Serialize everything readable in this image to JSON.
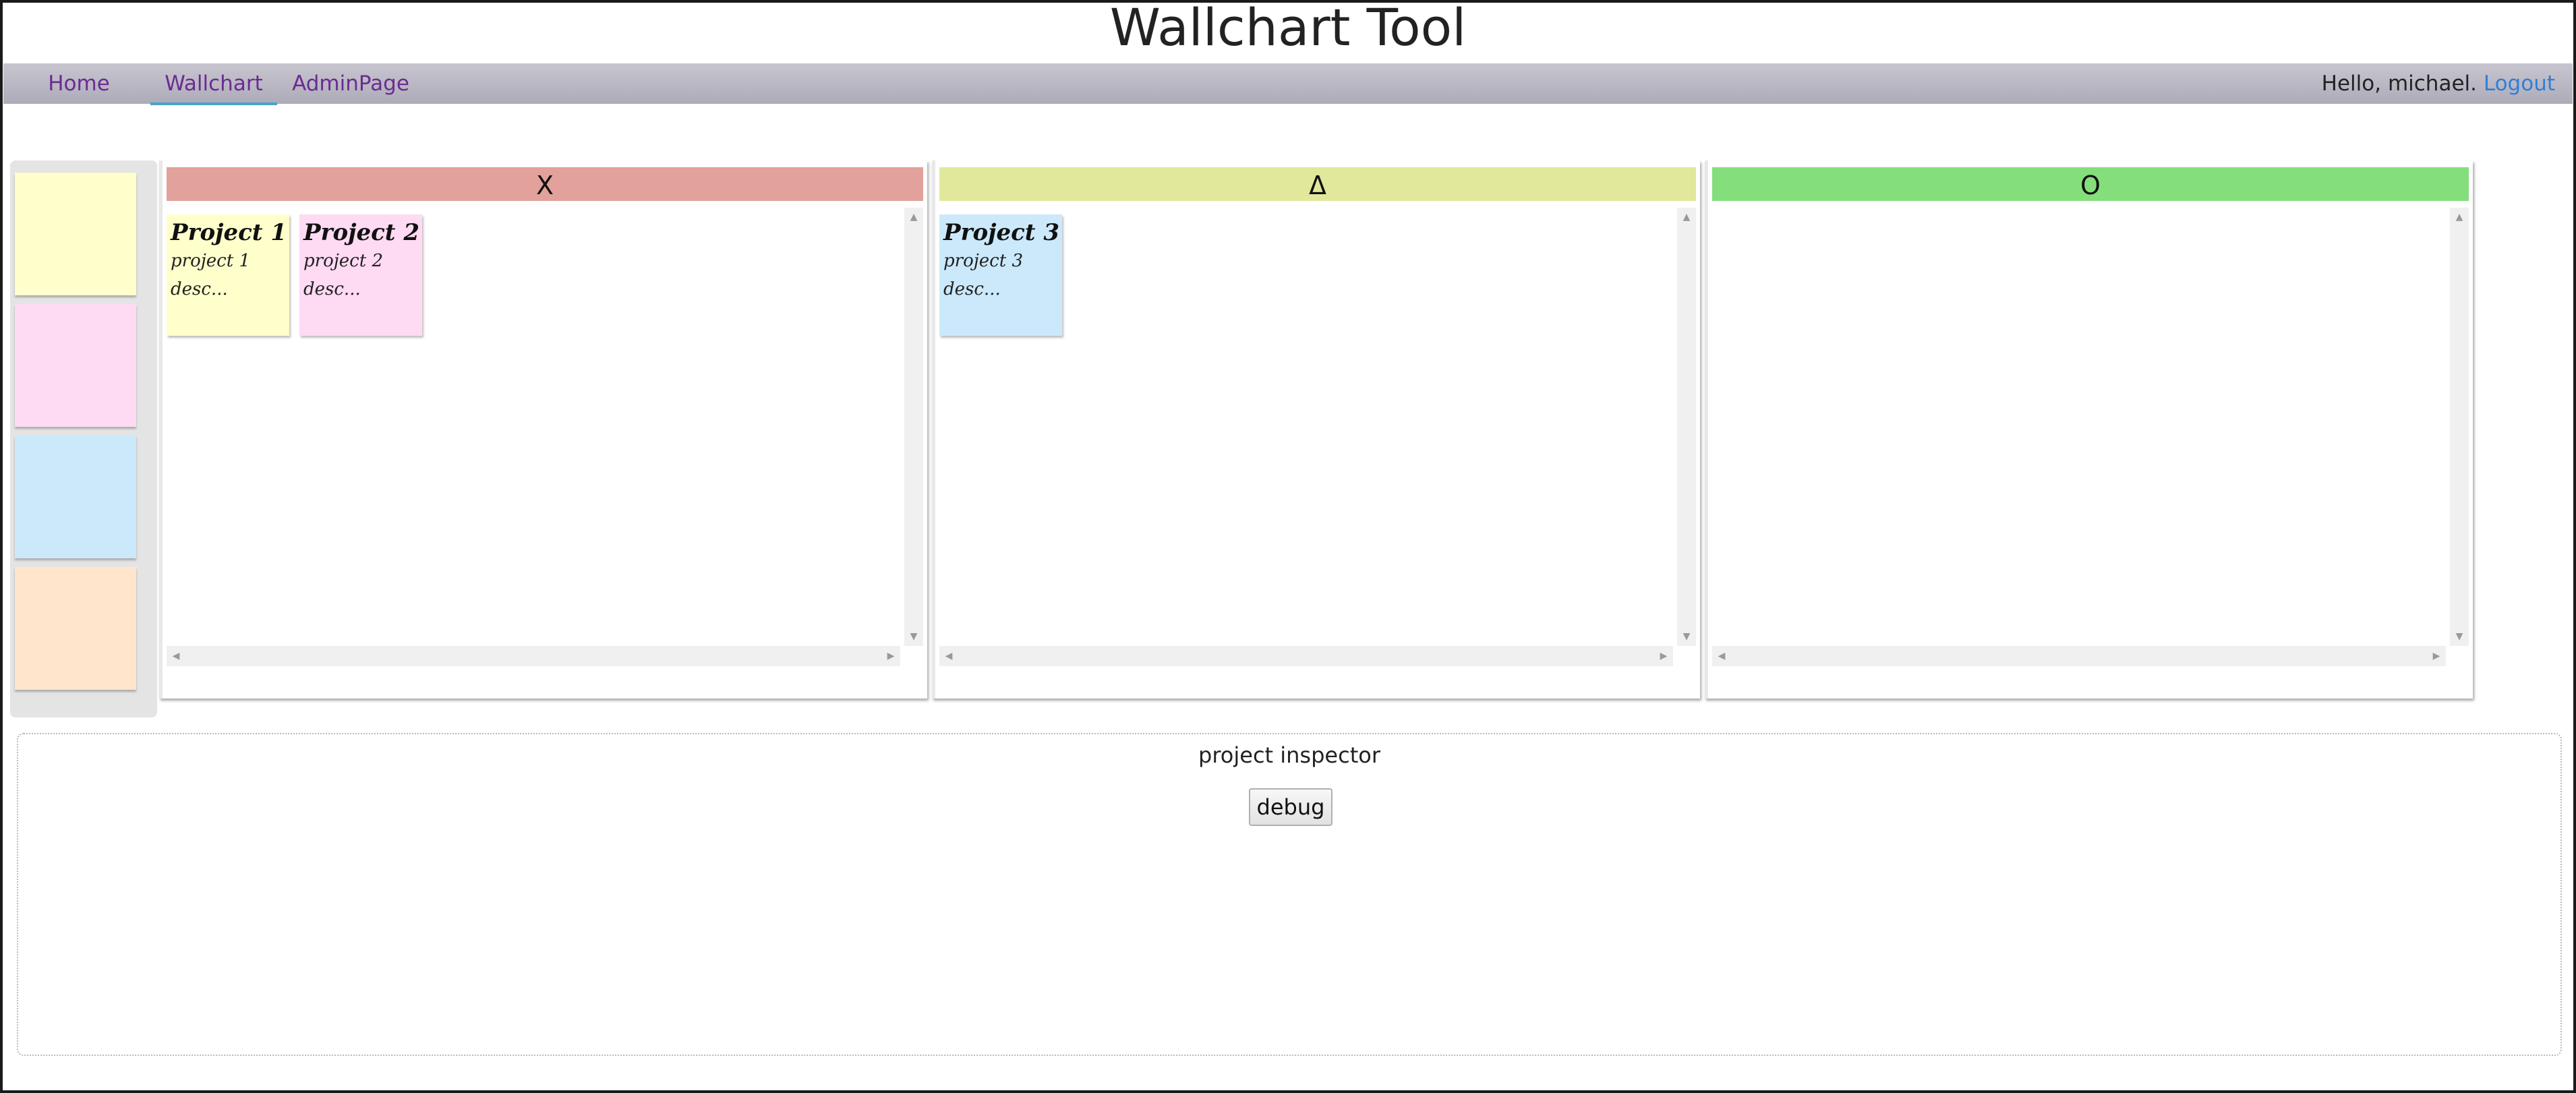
{
  "app": {
    "title": "Wallchart Tool"
  },
  "nav": {
    "items": [
      {
        "label": "Home"
      },
      {
        "label": "Wallchart"
      },
      {
        "label": "AdminPage"
      }
    ],
    "greeting": "Hello, michael.",
    "logout": "Logout"
  },
  "palette": {
    "swatches": [
      {
        "color": "#ffffcc"
      },
      {
        "color": "#ffdaf3"
      },
      {
        "color": "#cbe9fb"
      },
      {
        "color": "#ffe5cc"
      }
    ]
  },
  "columns": [
    {
      "header": "X",
      "color": "#e2a19a",
      "notes": [
        {
          "title": "Project 1",
          "desc": "project 1 desc...",
          "color": "#ffffcc"
        },
        {
          "title": "Project 2",
          "desc": "project 2 desc...",
          "color": "#ffdaf3"
        }
      ]
    },
    {
      "header": "Δ",
      "color": "#e1e89c",
      "notes": [
        {
          "title": "Project 3",
          "desc": "project 3 desc...",
          "color": "#cbe9fb"
        }
      ]
    },
    {
      "header": "O",
      "color": "#85de7c",
      "notes": []
    }
  ],
  "inspector": {
    "title": "project inspector",
    "debug_label": "debug"
  }
}
